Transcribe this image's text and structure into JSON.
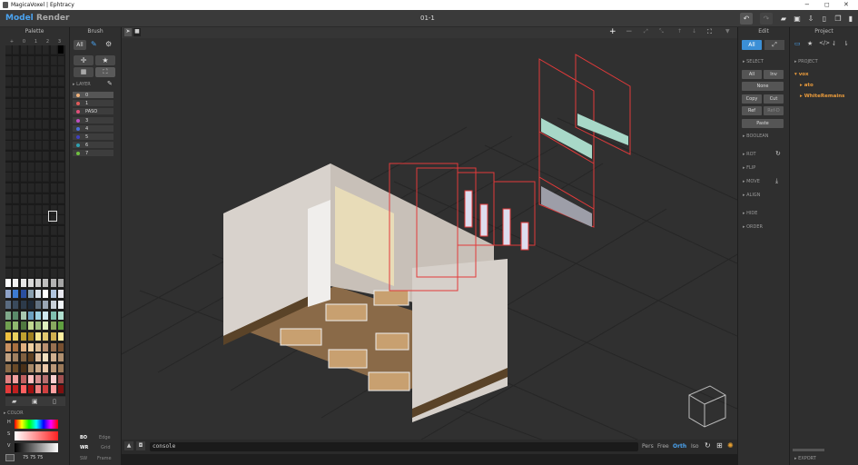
{
  "window": {
    "title": "MagicaVoxel | Ephtracy",
    "controls": [
      "−",
      "◻",
      "✕"
    ]
  },
  "menu": {
    "model": "Model",
    "render": "Render",
    "filename": "01-1"
  },
  "colors": {
    "accent": "#3b8fd6",
    "tree": "#e89a3c",
    "red": "#e23a3a"
  },
  "palette": {
    "title": "Palette",
    "page_tabs": [
      "+",
      "0",
      "1",
      "2",
      "3"
    ],
    "color_section": "COLOR",
    "hsv_labels": [
      "H",
      "S",
      "V"
    ],
    "rgb": "75  75  75"
  },
  "brush": {
    "title": "Brush",
    "mode": "All",
    "layer_header": "LAYER",
    "layers": [
      {
        "name": "0",
        "color": "#f0b27a"
      },
      {
        "name": "1",
        "color": "#e05a5a"
      },
      {
        "name": "PASO",
        "color": "#e0507a"
      },
      {
        "name": "3",
        "color": "#c050c0"
      },
      {
        "name": "4",
        "color": "#4a70d8"
      },
      {
        "name": "5",
        "color": "#4040c0"
      },
      {
        "name": "6",
        "color": "#30a0b0"
      },
      {
        "name": "7",
        "color": "#70c040"
      }
    ],
    "bottom": [
      [
        "BO",
        "Edge"
      ],
      [
        "WR",
        "Grid"
      ],
      [
        "SW",
        "Frame"
      ]
    ]
  },
  "viewport": {
    "console_text": "console",
    "view_modes": [
      "Pers",
      "Free",
      "Orth",
      "Iso"
    ],
    "active_mode": "Orth"
  },
  "edit": {
    "title": "Edit",
    "modes": [
      "All"
    ],
    "sections": {
      "select": "SELECT",
      "boolean": "BOOLEAN",
      "rot": "ROT",
      "flip": "FLIP",
      "move": "MOVE",
      "align": "ALIGN",
      "hide": "HIDE",
      "order": "ORDER"
    },
    "select_buttons": [
      "All",
      "Inv",
      "None",
      "Copy",
      "Cut",
      "Ref",
      "Ref-D",
      "Paste"
    ]
  },
  "project": {
    "title": "Project",
    "header": "PROJECT",
    "tree": [
      "vox",
      "ato",
      "WhiteRemains"
    ],
    "export": "EXPORT"
  }
}
